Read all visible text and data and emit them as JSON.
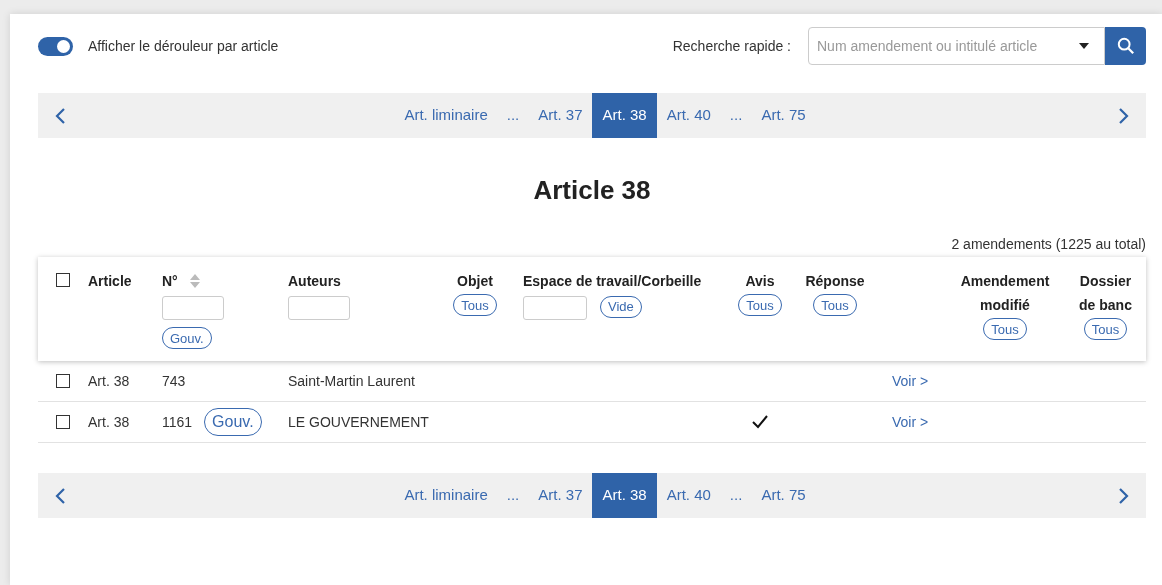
{
  "toggle": {
    "on": true,
    "label": "Afficher le dérouleur par article"
  },
  "search": {
    "label": "Recherche rapide :",
    "placeholder": "Num amendement ou intitulé article"
  },
  "pager_top": {
    "items": [
      {
        "kind": "link",
        "label": "Art. liminaire",
        "selected": false
      },
      {
        "kind": "ellipsis",
        "label": "..."
      },
      {
        "kind": "link",
        "label": "Art. 37",
        "selected": false
      },
      {
        "kind": "link",
        "label": "Art. 38",
        "selected": true
      },
      {
        "kind": "link",
        "label": "Art. 40",
        "selected": false
      },
      {
        "kind": "ellipsis",
        "label": "..."
      },
      {
        "kind": "link",
        "label": "Art. 75",
        "selected": false
      }
    ]
  },
  "heading": "Article 38",
  "count": "2 amendements (1225 au total)",
  "table": {
    "select_all": {
      "checked": false
    },
    "columns": [
      {
        "kind": "plain",
        "label": "Article"
      },
      {
        "kind": "stack",
        "label": "N°",
        "sortable": true,
        "chips": [
          "Gouv."
        ]
      },
      {
        "kind": "input",
        "label": "Auteurs"
      },
      {
        "kind": "center",
        "label": "Objet",
        "chips": [
          "Tous"
        ]
      },
      {
        "kind": "inline",
        "label": "Espace de travail/Corbeille",
        "chips": [
          "Vide"
        ]
      },
      {
        "kind": "center",
        "label": "Avis",
        "chips": [
          "Tous"
        ]
      },
      {
        "kind": "center",
        "label": "Réponse",
        "chips": [
          "Tous"
        ]
      },
      {
        "kind": "empty"
      },
      {
        "kind": "center",
        "label": "Amendement modifié",
        "chips": [
          "Tous"
        ]
      },
      {
        "kind": "center",
        "label": "Dossier de banc",
        "chips": [
          "Tous"
        ]
      }
    ],
    "rows": [
      {
        "checked": false,
        "article": "Art. 38",
        "number": "743",
        "author": "Saint-Martin Laurent",
        "avis": false,
        "link": "Voir >"
      },
      {
        "checked": false,
        "article": "Art. 38",
        "number": "1161",
        "badge": "Gouv.",
        "author": "LE GOUVERNEMENT",
        "avis": true,
        "link": "Voir >"
      }
    ]
  },
  "pager_bottom": {
    "items": [
      {
        "kind": "link",
        "label": "Art. liminaire",
        "selected": false
      },
      {
        "kind": "ellipsis",
        "label": "..."
      },
      {
        "kind": "link",
        "label": "Art. 37",
        "selected": false
      },
      {
        "kind": "link",
        "label": "Art. 38",
        "selected": true
      },
      {
        "kind": "link",
        "label": "Art. 40",
        "selected": false
      },
      {
        "kind": "ellipsis",
        "label": "..."
      },
      {
        "kind": "link",
        "label": "Art. 75",
        "selected": false
      }
    ]
  }
}
